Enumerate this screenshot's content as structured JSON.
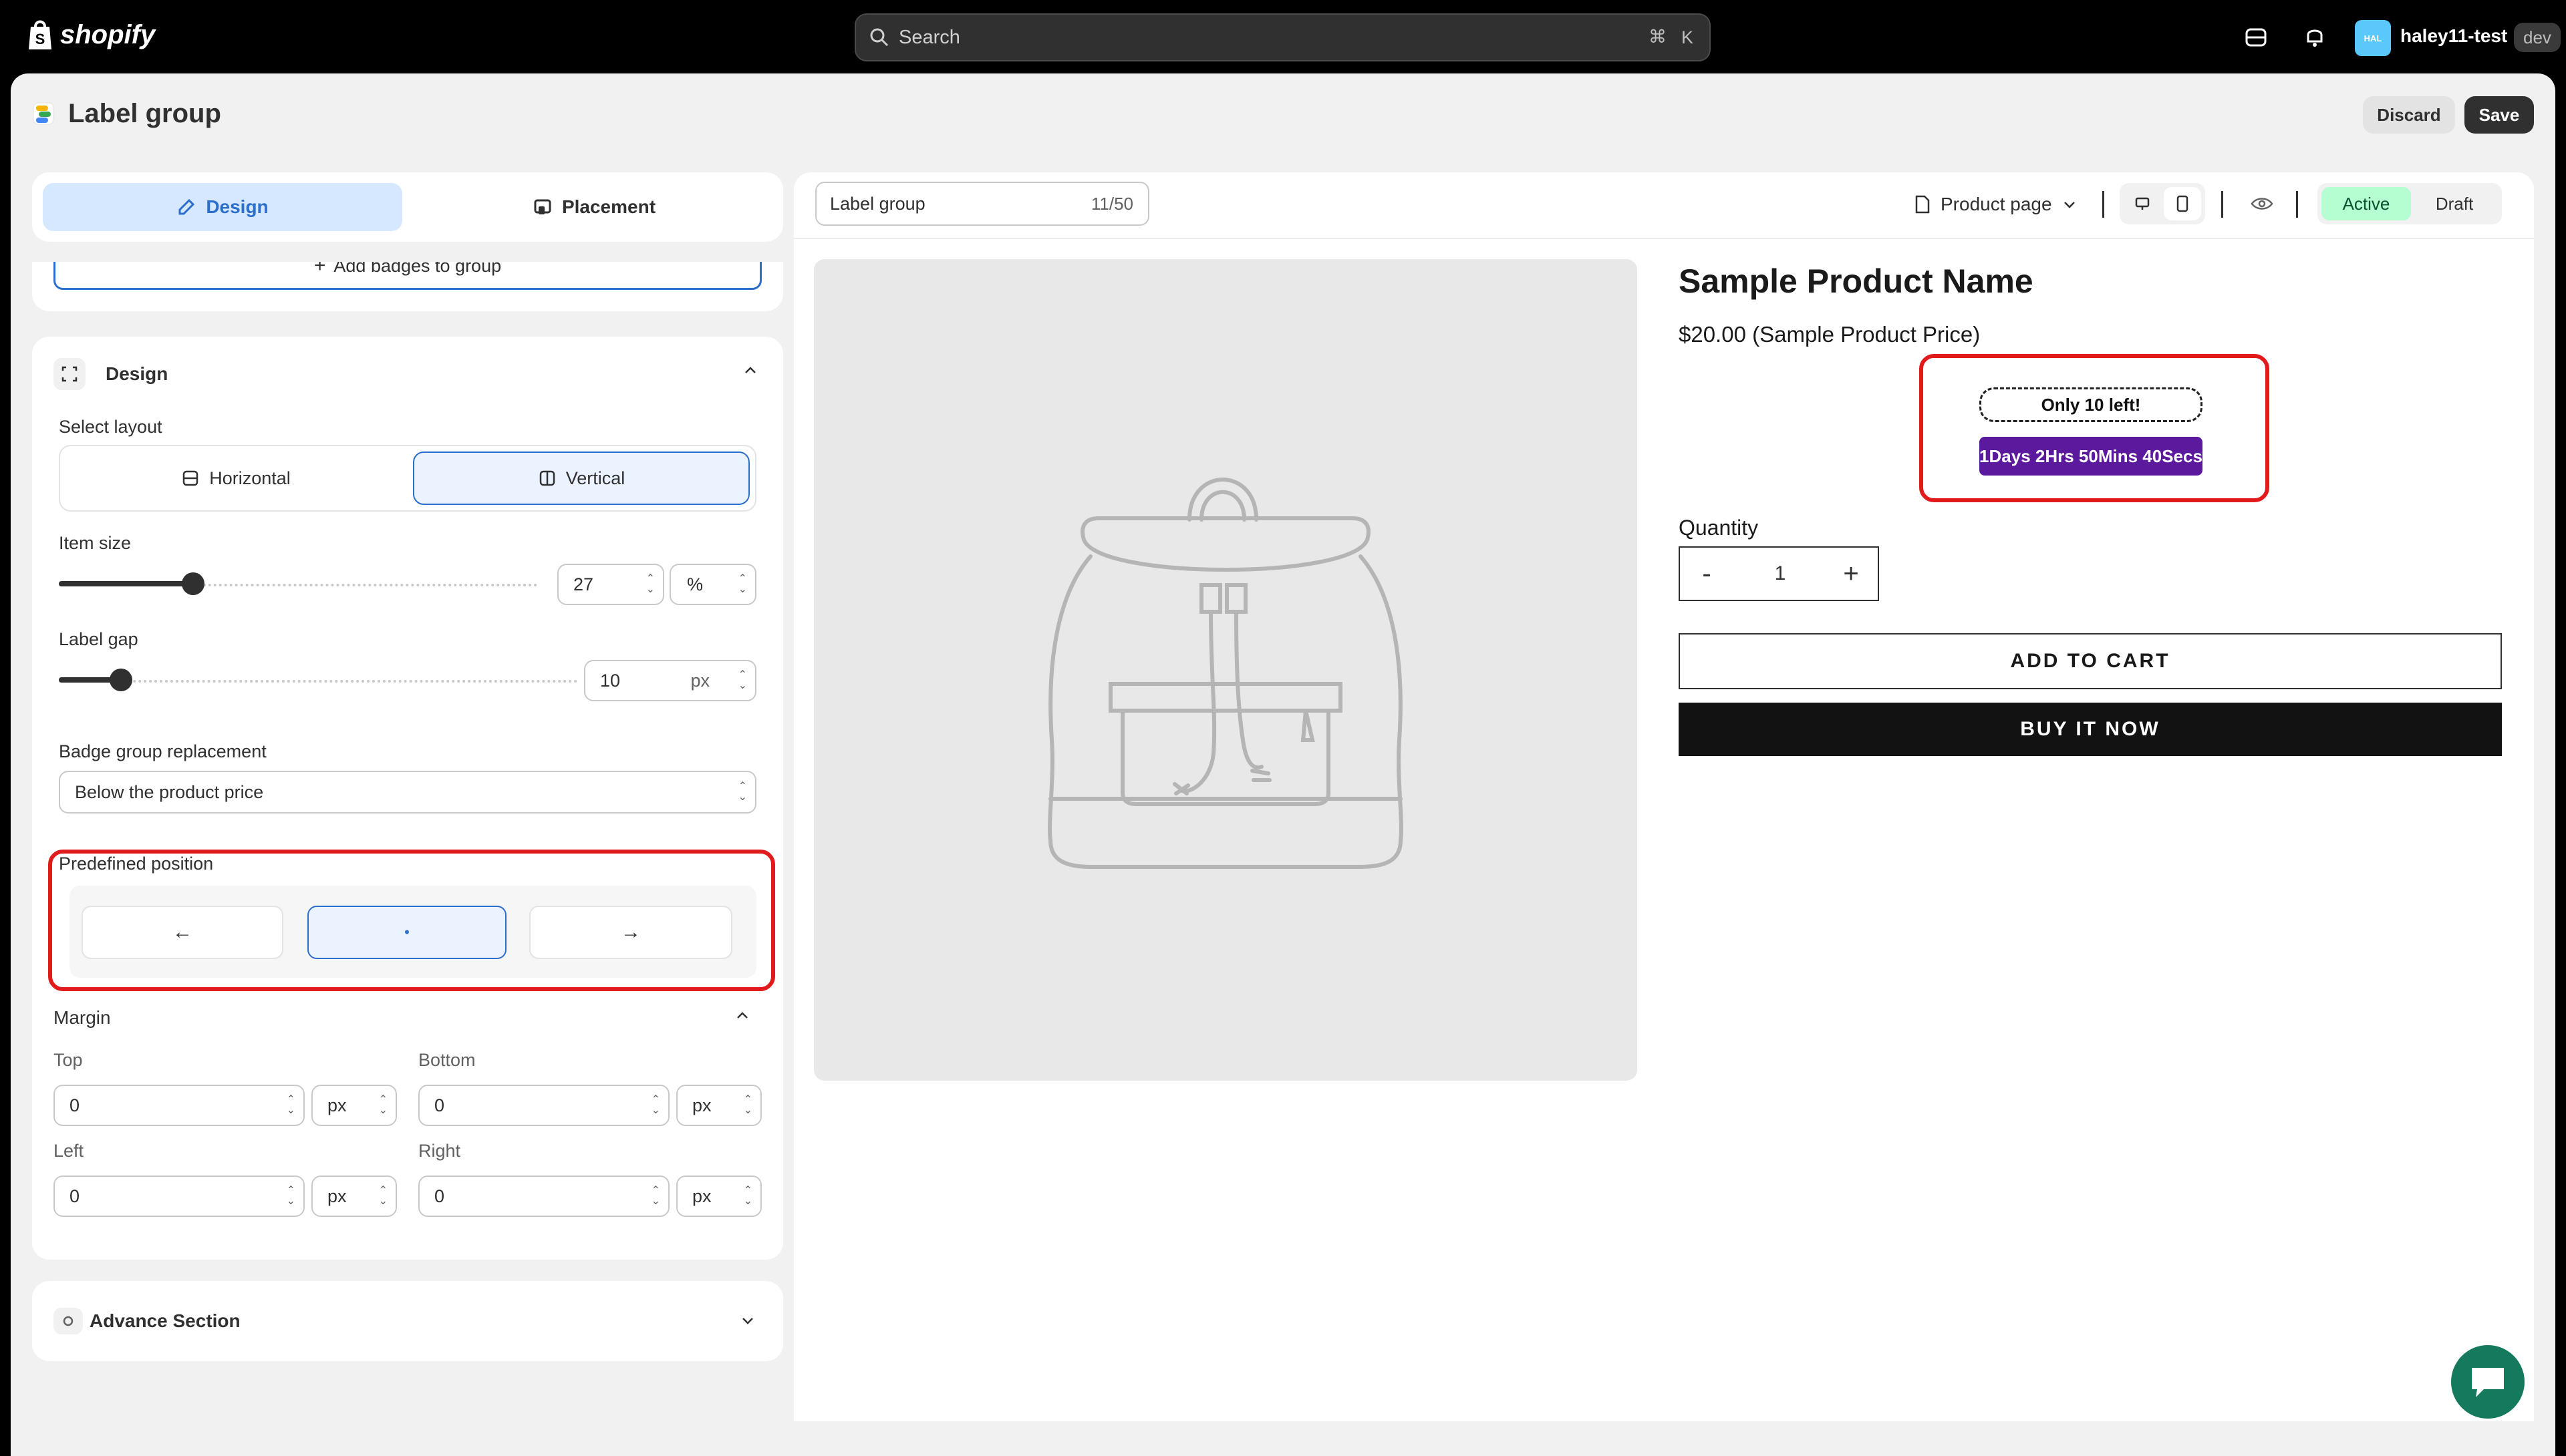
{
  "topbar": {
    "logo_text": "shopify",
    "search_placeholder": "Search",
    "shortcut_cmd": "⌘",
    "shortcut_key": "K",
    "avatar_initials": "HAL",
    "store_name": "haley11-test",
    "store_badge": "dev"
  },
  "page": {
    "title": "Label group",
    "discard_label": "Discard",
    "save_label": "Save"
  },
  "left_panel": {
    "tabs": [
      {
        "label": "Design",
        "active": true
      },
      {
        "label": "Placement",
        "active": false
      }
    ],
    "add_badges_label": "Add badges to group",
    "design_section": {
      "title": "Design",
      "select_layout_label": "Select layout",
      "layouts": [
        {
          "label": "Horizontal",
          "selected": false
        },
        {
          "label": "Vertical",
          "selected": true
        }
      ],
      "item_size": {
        "label": "Item size",
        "value": "27",
        "unit": "%",
        "slider_fraction": 0.28
      },
      "label_gap": {
        "label": "Label gap",
        "value": "10",
        "unit": "px",
        "slider_fraction": 0.12
      },
      "badge_group_replacement": {
        "label": "Badge group replacement",
        "value": "Below the product price"
      },
      "predefined_position": {
        "label": "Predefined position",
        "options": [
          "←",
          "•",
          "→"
        ],
        "selected": 1
      }
    },
    "margin": {
      "title": "Margin",
      "fields": [
        {
          "label": "Top",
          "value": "0",
          "unit": "px"
        },
        {
          "label": "Bottom",
          "value": "0",
          "unit": "px"
        },
        {
          "label": "Left",
          "value": "0",
          "unit": "px"
        },
        {
          "label": "Right",
          "value": "0",
          "unit": "px"
        }
      ]
    },
    "advance_section": {
      "title": "Advance Section"
    }
  },
  "preview": {
    "name_input": "Label group",
    "char_count": "11/50",
    "page_selector": "Product page",
    "status_active": "Active",
    "status_draft": "Draft",
    "product": {
      "name": "Sample Product Name",
      "price": "$20.00 (Sample Product Price)",
      "badge1": "Only 10 left!",
      "badge2": "1Days 2Hrs 50Mins 40Secs",
      "quantity_label": "Quantity",
      "qty_minus": "-",
      "qty_value": "1",
      "qty_plus": "+",
      "add_to_cart": "ADD TO CART",
      "buy_now": "BUY IT NOW"
    }
  },
  "colors": {
    "accent_blue": "#2c6ecb",
    "active_green": "#b4fed2",
    "highlight_red": "#e11b1b",
    "timer_purple": "#5b1a9e"
  }
}
